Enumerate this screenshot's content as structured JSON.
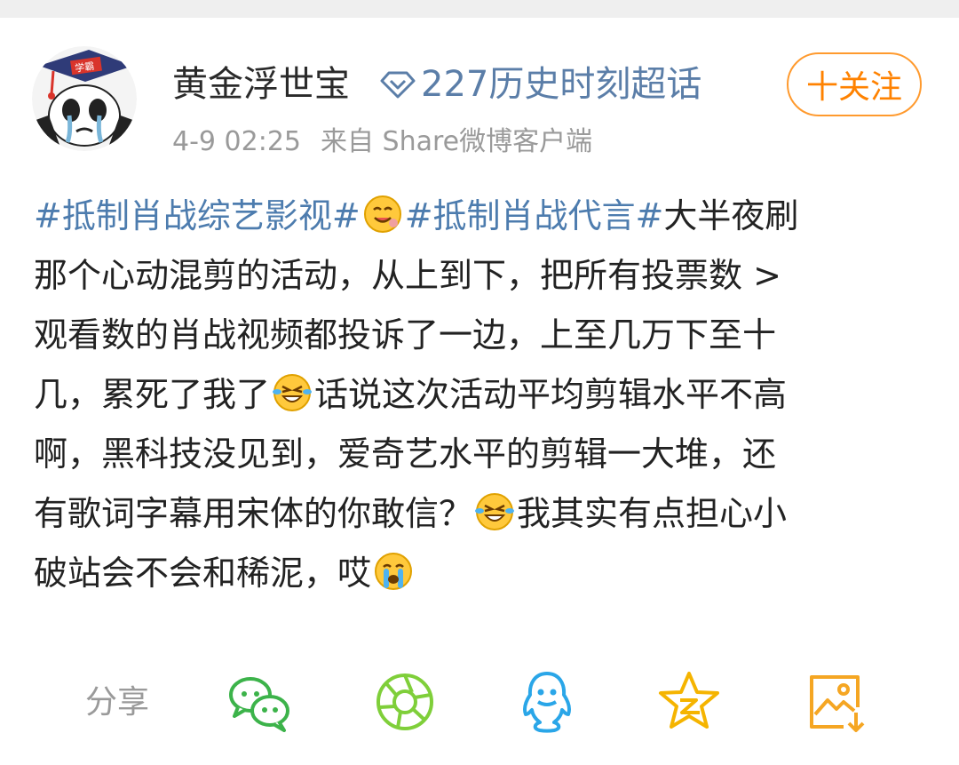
{
  "author": {
    "name": "黄金浮世宝",
    "badge_icon": "diamond-icon",
    "badge_text": "227历史时刻超话",
    "avatar_icon": "panda-graduate-avatar"
  },
  "follow_button": {
    "label": "十关注"
  },
  "meta": {
    "time": "4-9 02:25",
    "source": "来自 Share微博客户端"
  },
  "post": {
    "tag1": "#抵制肖战综艺影视#",
    "tag2": "#抵制肖战代言#",
    "line1_text": "大半夜刷",
    "line2": "那个心动混剪的活动，从上到下，把所有投票数 >",
    "line3": "观看数的肖战视频都投诉了一边，上至几万下至十",
    "line4_a": "几，累死了我了",
    "line4_b": "话说这次活动平均剪辑水平不高",
    "line5": "啊，黑科技没见到，爱奇艺水平的剪辑一大堆，还",
    "line6_a": "有歌词字幕用宋体的你敢信？",
    "line6_b": "我其实有点担心小",
    "line7": "破站会不会和稀泥，哎"
  },
  "share": {
    "label": "分享",
    "targets": [
      "wechat-icon",
      "moments-icon",
      "qq-icon",
      "qzone-icon",
      "save-image-icon"
    ]
  },
  "colors": {
    "tag": "#4d7cae",
    "badge": "#5b7ea8",
    "follow": "#ff8200",
    "wechat": "#3cb34a",
    "moments": "#7fcf3a",
    "qq": "#2aa6e8",
    "qzone": "#f5b400",
    "save": "#f5a623"
  }
}
